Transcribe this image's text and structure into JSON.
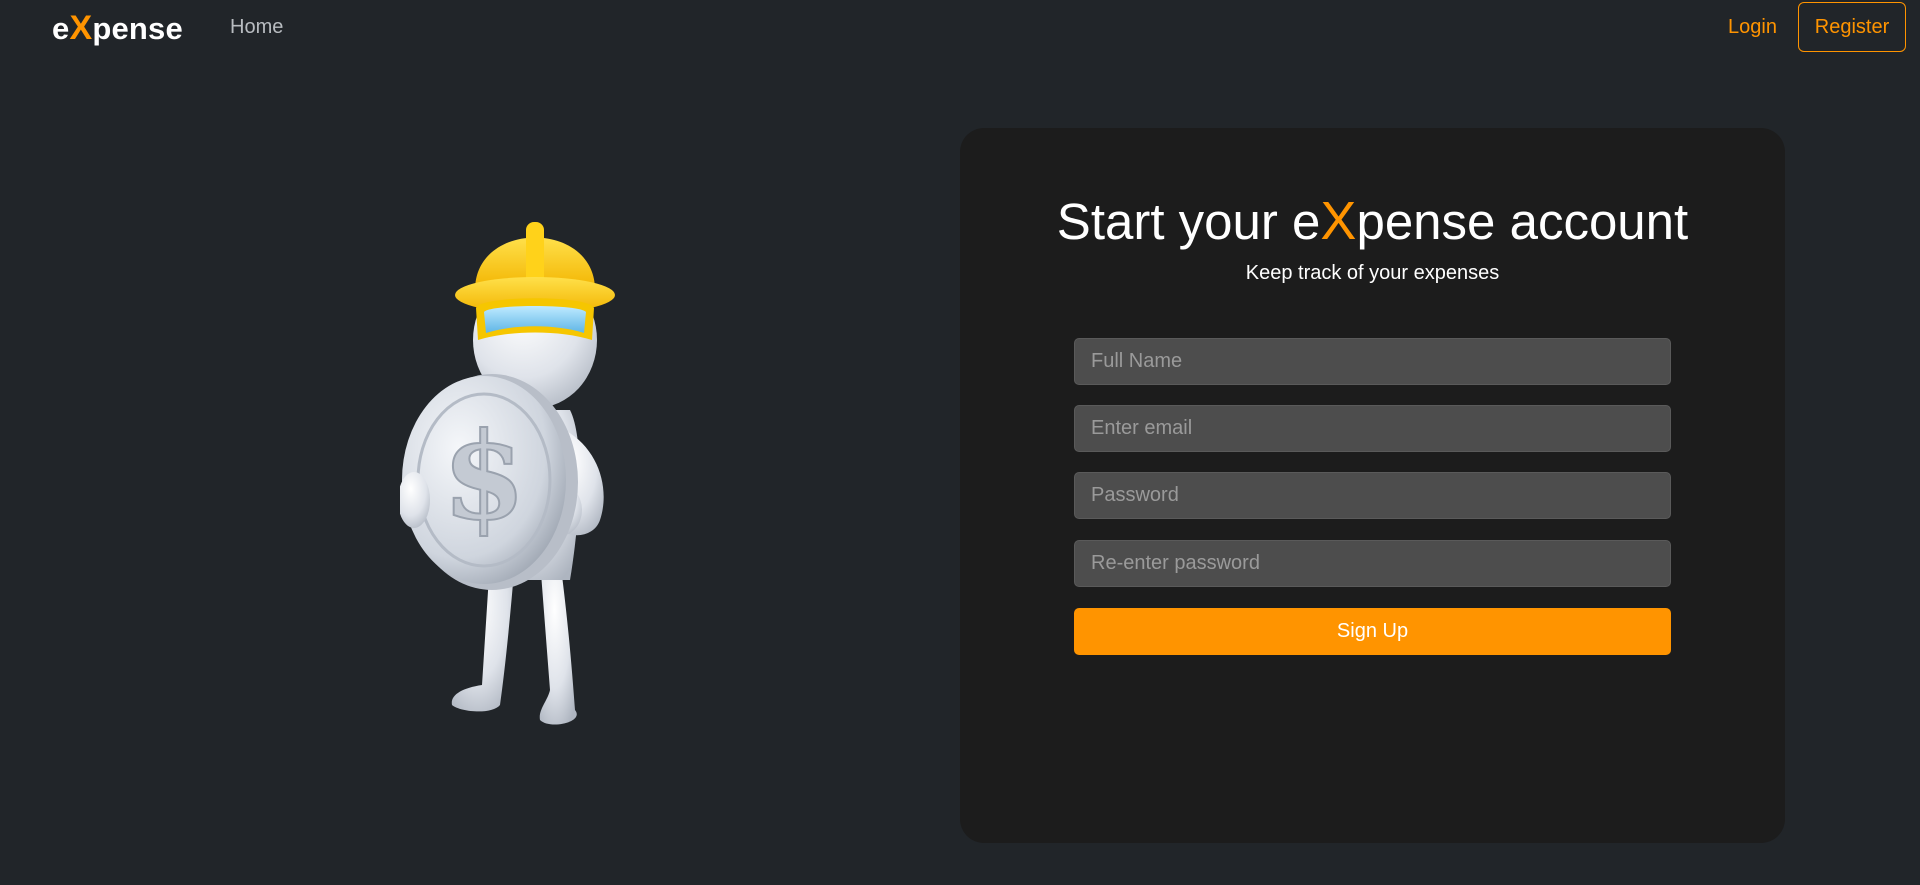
{
  "navbar": {
    "brand_prefix": "e",
    "brand_x": "X",
    "brand_suffix": "pense",
    "home_label": "Home",
    "login_label": "Login",
    "register_label": "Register"
  },
  "card": {
    "title_prefix": "Start your e",
    "title_x": "X",
    "title_suffix": "pense account",
    "subtitle": "Keep track of your expenses",
    "fields": {
      "full_name_placeholder": "Full Name",
      "email_placeholder": "Enter email",
      "password_placeholder": "Password",
      "reenter_password_placeholder": "Re-enter password"
    },
    "signup_label": "Sign Up"
  },
  "colors": {
    "accent": "#ff9400",
    "background": "#212529",
    "card": "#1c1c1c",
    "input": "#4d4d4d"
  },
  "icons": {
    "mascot": "worker-with-dollar-coin-illustration"
  }
}
